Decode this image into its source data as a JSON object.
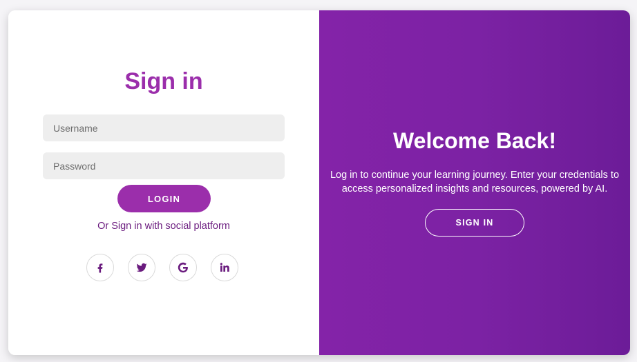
{
  "sign_in": {
    "title": "Sign in",
    "username_placeholder": "Username",
    "password_placeholder": "Password",
    "login_label": "LOGIN",
    "social_text": "Or Sign in with social platform",
    "socials": [
      {
        "name": "facebook",
        "icon": "facebook-icon"
      },
      {
        "name": "twitter",
        "icon": "twitter-icon"
      },
      {
        "name": "google",
        "icon": "google-icon"
      },
      {
        "name": "linkedin",
        "icon": "linkedin-icon"
      }
    ]
  },
  "welcome_panel": {
    "title": "Welcome Back!",
    "description": "Log in to continue your learning journey. Enter your credentials to access personalized insights and resources, powered by AI.",
    "signin_label": "SIGN IN"
  },
  "colors": {
    "accent": "#9b2eab",
    "accent_dark": "#6a1b7e",
    "panel_gradient_start": "#8423a8",
    "panel_gradient_end": "#6c1c98",
    "input_bg": "#eeeeee"
  }
}
